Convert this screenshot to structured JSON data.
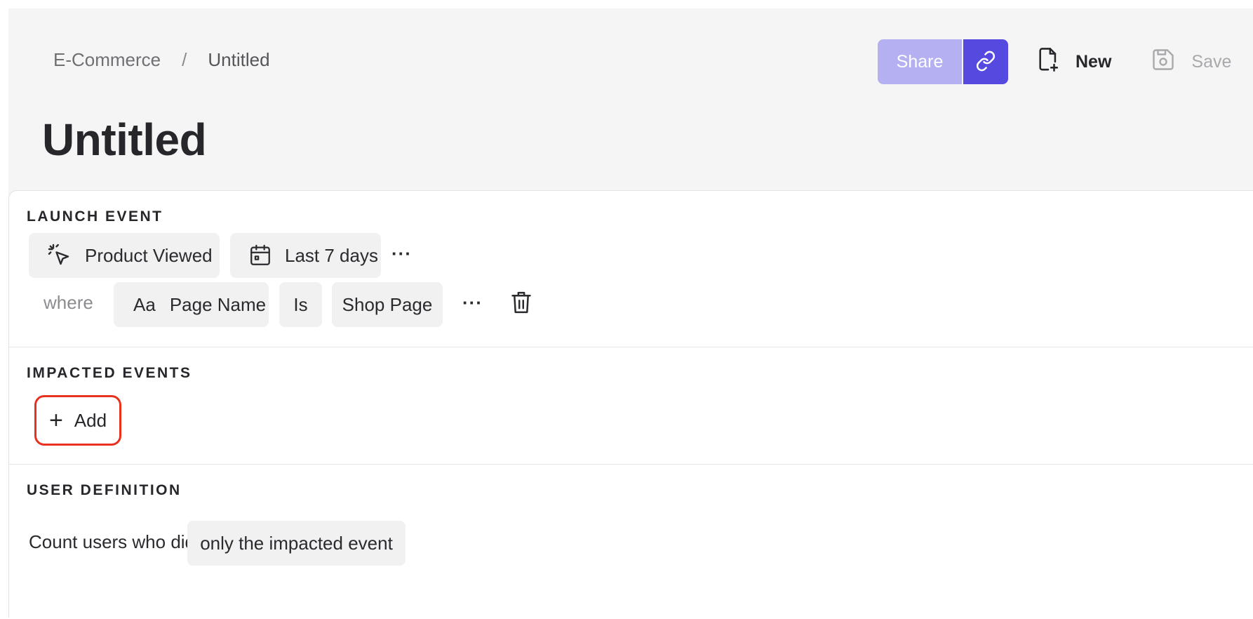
{
  "breadcrumb": {
    "parent": "E-Commerce",
    "separator": "/",
    "current": "Untitled"
  },
  "page_title": "Untitled",
  "toolbar": {
    "share_label": "Share",
    "new_label": "New",
    "save_label": "Save"
  },
  "launch_event": {
    "section_label": "LAUNCH EVENT",
    "event_name": "Product Viewed",
    "date_range": "Last 7 days",
    "more_label": "···",
    "filter": {
      "where_label": "where",
      "property_type": "Aa",
      "property_name": "Page Name",
      "operator": "Is",
      "value": "Shop Page",
      "more_label": "···"
    }
  },
  "impacted_events": {
    "section_label": "IMPACTED EVENTS",
    "add_label": "Add"
  },
  "user_definition": {
    "section_label": "USER DEFINITION",
    "prefix": "Count users who did",
    "selection": "only the impacted event"
  },
  "colors": {
    "accent": "#5549e0",
    "accent_light": "#b4b0f1",
    "highlight": "#e8311f"
  }
}
